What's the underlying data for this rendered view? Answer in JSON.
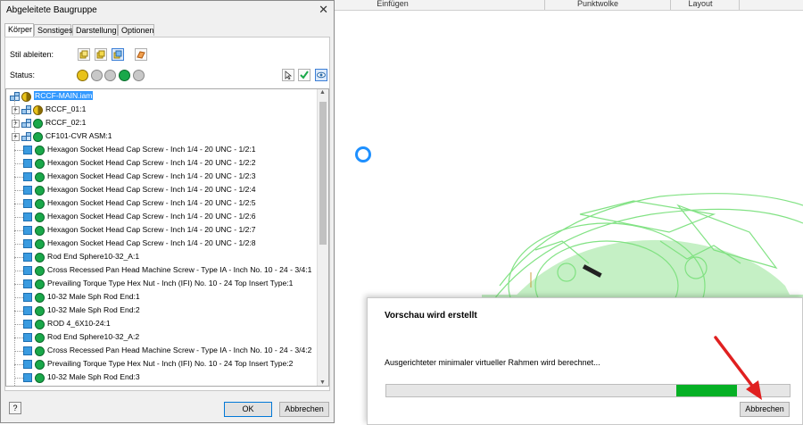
{
  "app": {
    "ribbon_tabs": [
      "Einfügen",
      "Punktwolke",
      "Layout"
    ]
  },
  "dialog": {
    "title": "Abgeleitete Baugruppe",
    "tabs": [
      "Körper",
      "Sonstiges",
      "Darstellung",
      "Optionen"
    ],
    "active_tab": "Körper",
    "stil_label": "Stil ableiten:",
    "status_label": "Status:",
    "tree": [
      {
        "label": "RCCF-MAIN.iam",
        "kind": "asm",
        "state": "mixed",
        "level": 0,
        "expander": false,
        "selected": true
      },
      {
        "label": "RCCF_01:1",
        "kind": "asm",
        "state": "mixed",
        "level": 1,
        "expander": true
      },
      {
        "label": "RCCF_02:1",
        "kind": "asm",
        "state": "include",
        "level": 1,
        "expander": true
      },
      {
        "label": "CF101-CVR ASM:1",
        "kind": "asm",
        "state": "include",
        "level": 1,
        "expander": true
      },
      {
        "label": "Hexagon Socket Head Cap Screw - Inch 1/4 - 20 UNC - 1/2:1",
        "kind": "part",
        "state": "include",
        "level": 1
      },
      {
        "label": "Hexagon Socket Head Cap Screw - Inch 1/4 - 20 UNC - 1/2:2",
        "kind": "part",
        "state": "include",
        "level": 1
      },
      {
        "label": "Hexagon Socket Head Cap Screw - Inch 1/4 - 20 UNC - 1/2:3",
        "kind": "part",
        "state": "include",
        "level": 1
      },
      {
        "label": "Hexagon Socket Head Cap Screw - Inch 1/4 - 20 UNC - 1/2:4",
        "kind": "part",
        "state": "include",
        "level": 1
      },
      {
        "label": "Hexagon Socket Head Cap Screw - Inch 1/4 - 20 UNC - 1/2:5",
        "kind": "part",
        "state": "include",
        "level": 1
      },
      {
        "label": "Hexagon Socket Head Cap Screw - Inch 1/4 - 20 UNC - 1/2:6",
        "kind": "part",
        "state": "include",
        "level": 1
      },
      {
        "label": "Hexagon Socket Head Cap Screw - Inch 1/4 - 20 UNC - 1/2:7",
        "kind": "part",
        "state": "include",
        "level": 1
      },
      {
        "label": "Hexagon Socket Head Cap Screw - Inch 1/4 - 20 UNC - 1/2:8",
        "kind": "part",
        "state": "include",
        "level": 1
      },
      {
        "label": "Rod End Sphere10-32_A:1",
        "kind": "part",
        "state": "include",
        "level": 1
      },
      {
        "label": "Cross Recessed Pan Head Machine Screw - Type IA - Inch No. 10 - 24 - 3/4:1",
        "kind": "part",
        "state": "include",
        "level": 1
      },
      {
        "label": "Prevailing Torque Type Hex Nut - Inch (IFI) No. 10 - 24 Top Insert Type:1",
        "kind": "part",
        "state": "include",
        "level": 1
      },
      {
        "label": "10-32 Male Sph Rod End:1",
        "kind": "part",
        "state": "include",
        "level": 1
      },
      {
        "label": "10-32 Male Sph Rod End:2",
        "kind": "part",
        "state": "include",
        "level": 1
      },
      {
        "label": "ROD 4_6X10-24:1",
        "kind": "part",
        "state": "include",
        "level": 1
      },
      {
        "label": "Rod End Sphere10-32_A:2",
        "kind": "part",
        "state": "include",
        "level": 1
      },
      {
        "label": "Cross Recessed Pan Head Machine Screw - Type IA - Inch No. 10 - 24 - 3/4:2",
        "kind": "part",
        "state": "include",
        "level": 1
      },
      {
        "label": "Prevailing Torque Type Hex Nut - Inch (IFI) No. 10 - 24 Top Insert Type:2",
        "kind": "part",
        "state": "include",
        "level": 1
      },
      {
        "label": "10-32 Male Sph Rod End:3",
        "kind": "part",
        "state": "include",
        "level": 1
      }
    ],
    "ok_label": "OK",
    "cancel_label": "Abbrechen",
    "help_label": "?"
  },
  "progress": {
    "title": "Vorschau wird erstellt",
    "message": "Ausgerichteter minimaler virtueller Rahmen wird berechnet...",
    "indicator_range": [
      0.72,
      0.87
    ],
    "cancel_label": "Abbrechen"
  },
  "colors": {
    "include_green": "#1aa84a",
    "mixed_yellow": "#e8c21a",
    "part_blue": "#3a9be0",
    "progress_green": "#06b025",
    "selection_blue": "#3399ff",
    "arrow_red": "#e02020",
    "model_green": "#59d95c"
  }
}
